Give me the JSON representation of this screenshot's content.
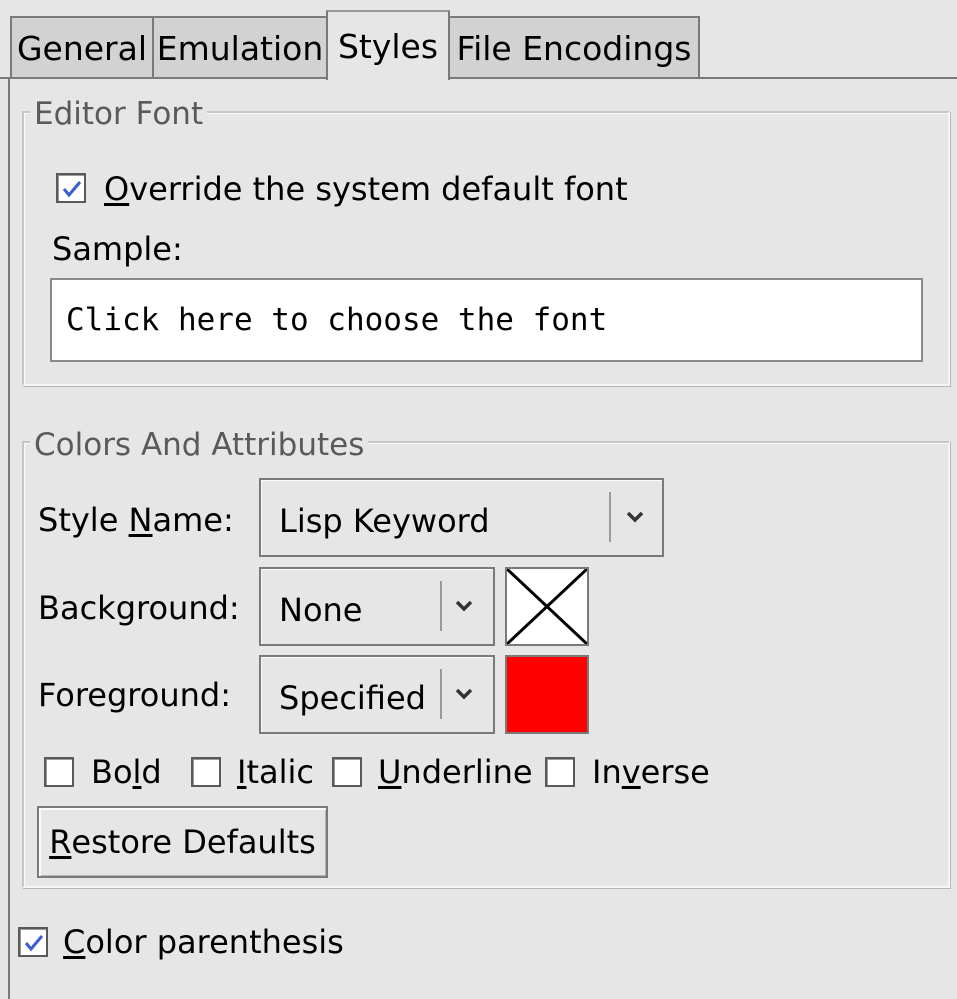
{
  "tabs": [
    {
      "label": "General",
      "active": false
    },
    {
      "label": "Emulation",
      "active": false
    },
    {
      "label": "Styles",
      "active": true
    },
    {
      "label": "File Encodings",
      "active": false
    }
  ],
  "editor_font": {
    "title": "Editor Font",
    "override_checkbox": {
      "accel": "O",
      "rest": "verride the system default font",
      "checked": true
    },
    "sample_label": "Sample:",
    "sample_text": "Click here to choose the font"
  },
  "colors": {
    "title": "Colors And Attributes",
    "style_name": {
      "label_pre": "Style ",
      "label_accel": "N",
      "label_post": "ame:",
      "value": "Lisp Keyword"
    },
    "background": {
      "label": "Background:",
      "value": "None"
    },
    "foreground": {
      "label": "Foreground:",
      "value": "Specified",
      "color": "#ff0000"
    },
    "attributes": [
      {
        "pre": "Bo",
        "accel": "l",
        "post": "d",
        "checked": false
      },
      {
        "pre": "",
        "accel": "I",
        "post": "talic",
        "checked": false
      },
      {
        "pre": "",
        "accel": "U",
        "post": "nderline",
        "checked": false
      },
      {
        "pre": "In",
        "accel": "v",
        "post": "erse",
        "checked": false
      }
    ],
    "restore_button": {
      "accel": "R",
      "rest": "estore Defaults"
    }
  },
  "color_parenthesis": {
    "accel": "C",
    "rest": "olor parenthesis",
    "checked": true
  },
  "colors_theme": {
    "check": "#3a5fcd",
    "window_bg": "#e6e6e6"
  }
}
